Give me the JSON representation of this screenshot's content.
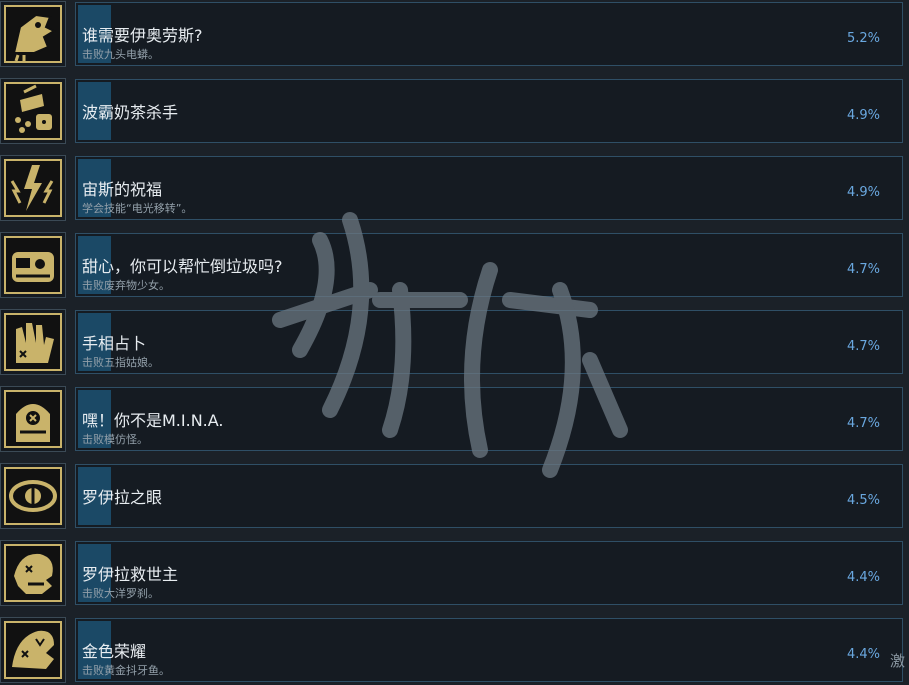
{
  "achievements": [
    {
      "title": "谁需要伊奥劳斯?",
      "desc": "击败九头电蟒。",
      "pct": "5.2%",
      "icon": "hydra-head-icon"
    },
    {
      "title": "波霸奶茶杀手",
      "desc": "",
      "pct": "4.9%",
      "icon": "bubble-tea-icon"
    },
    {
      "title": "宙斯的祝福",
      "desc": "学会技能“电光移转”。",
      "pct": "4.9%",
      "icon": "lightning-icon"
    },
    {
      "title": "甜心，你可以帮忙倒垃圾吗?",
      "desc": "击败废弃物少女。",
      "pct": "4.7%",
      "icon": "trash-monster-icon"
    },
    {
      "title": "手相占卜",
      "desc": "击败五指姑娘。",
      "pct": "4.7%",
      "icon": "hand-icon"
    },
    {
      "title": "嘿！你不是M.I.N.A.",
      "desc": "击败模仿怪。",
      "pct": "4.7%",
      "icon": "mimic-icon"
    },
    {
      "title": "罗伊拉之眼",
      "desc": "",
      "pct": "4.5%",
      "icon": "eye-icon"
    },
    {
      "title": "罗伊拉救世主",
      "desc": "击败大洋罗刹。",
      "pct": "4.4%",
      "icon": "sea-demon-icon"
    },
    {
      "title": "金色荣耀",
      "desc": "击败黄金抖牙鱼。",
      "pct": "4.4%",
      "icon": "golden-fish-icon"
    }
  ],
  "corner_text": "激",
  "colors": {
    "background": "#1b2128",
    "card_border": "#2f4f66",
    "bar": "#1b4966",
    "percent": "#6aa8e0",
    "icon_gold": "#c9b36a"
  }
}
